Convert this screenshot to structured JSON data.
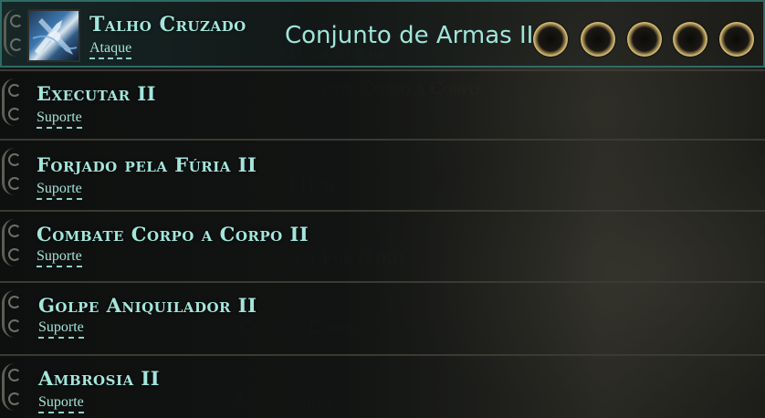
{
  "header": {
    "skill_name": "Talho Cruzado",
    "skill_type": "Ataque",
    "weapon_set": "Conjunto de Armas II",
    "socket_count": 5,
    "icon": "crossed-slash-skill-icon"
  },
  "supports": [
    {
      "name": "Executar II",
      "type": "Suporte"
    },
    {
      "name": "Forjado pela Fúria II",
      "type": "Suporte"
    },
    {
      "name": "Combate Corpo a Corpo II",
      "type": "Suporte"
    },
    {
      "name": "Golpe Aniquilador II",
      "type": "Suporte"
    },
    {
      "name": "Ambrosia II",
      "type": "Suporte"
    }
  ],
  "colors": {
    "name_text": "#a3e6dc",
    "header_border": "#2f6a66",
    "socket_rim": "#d9bf78"
  }
}
